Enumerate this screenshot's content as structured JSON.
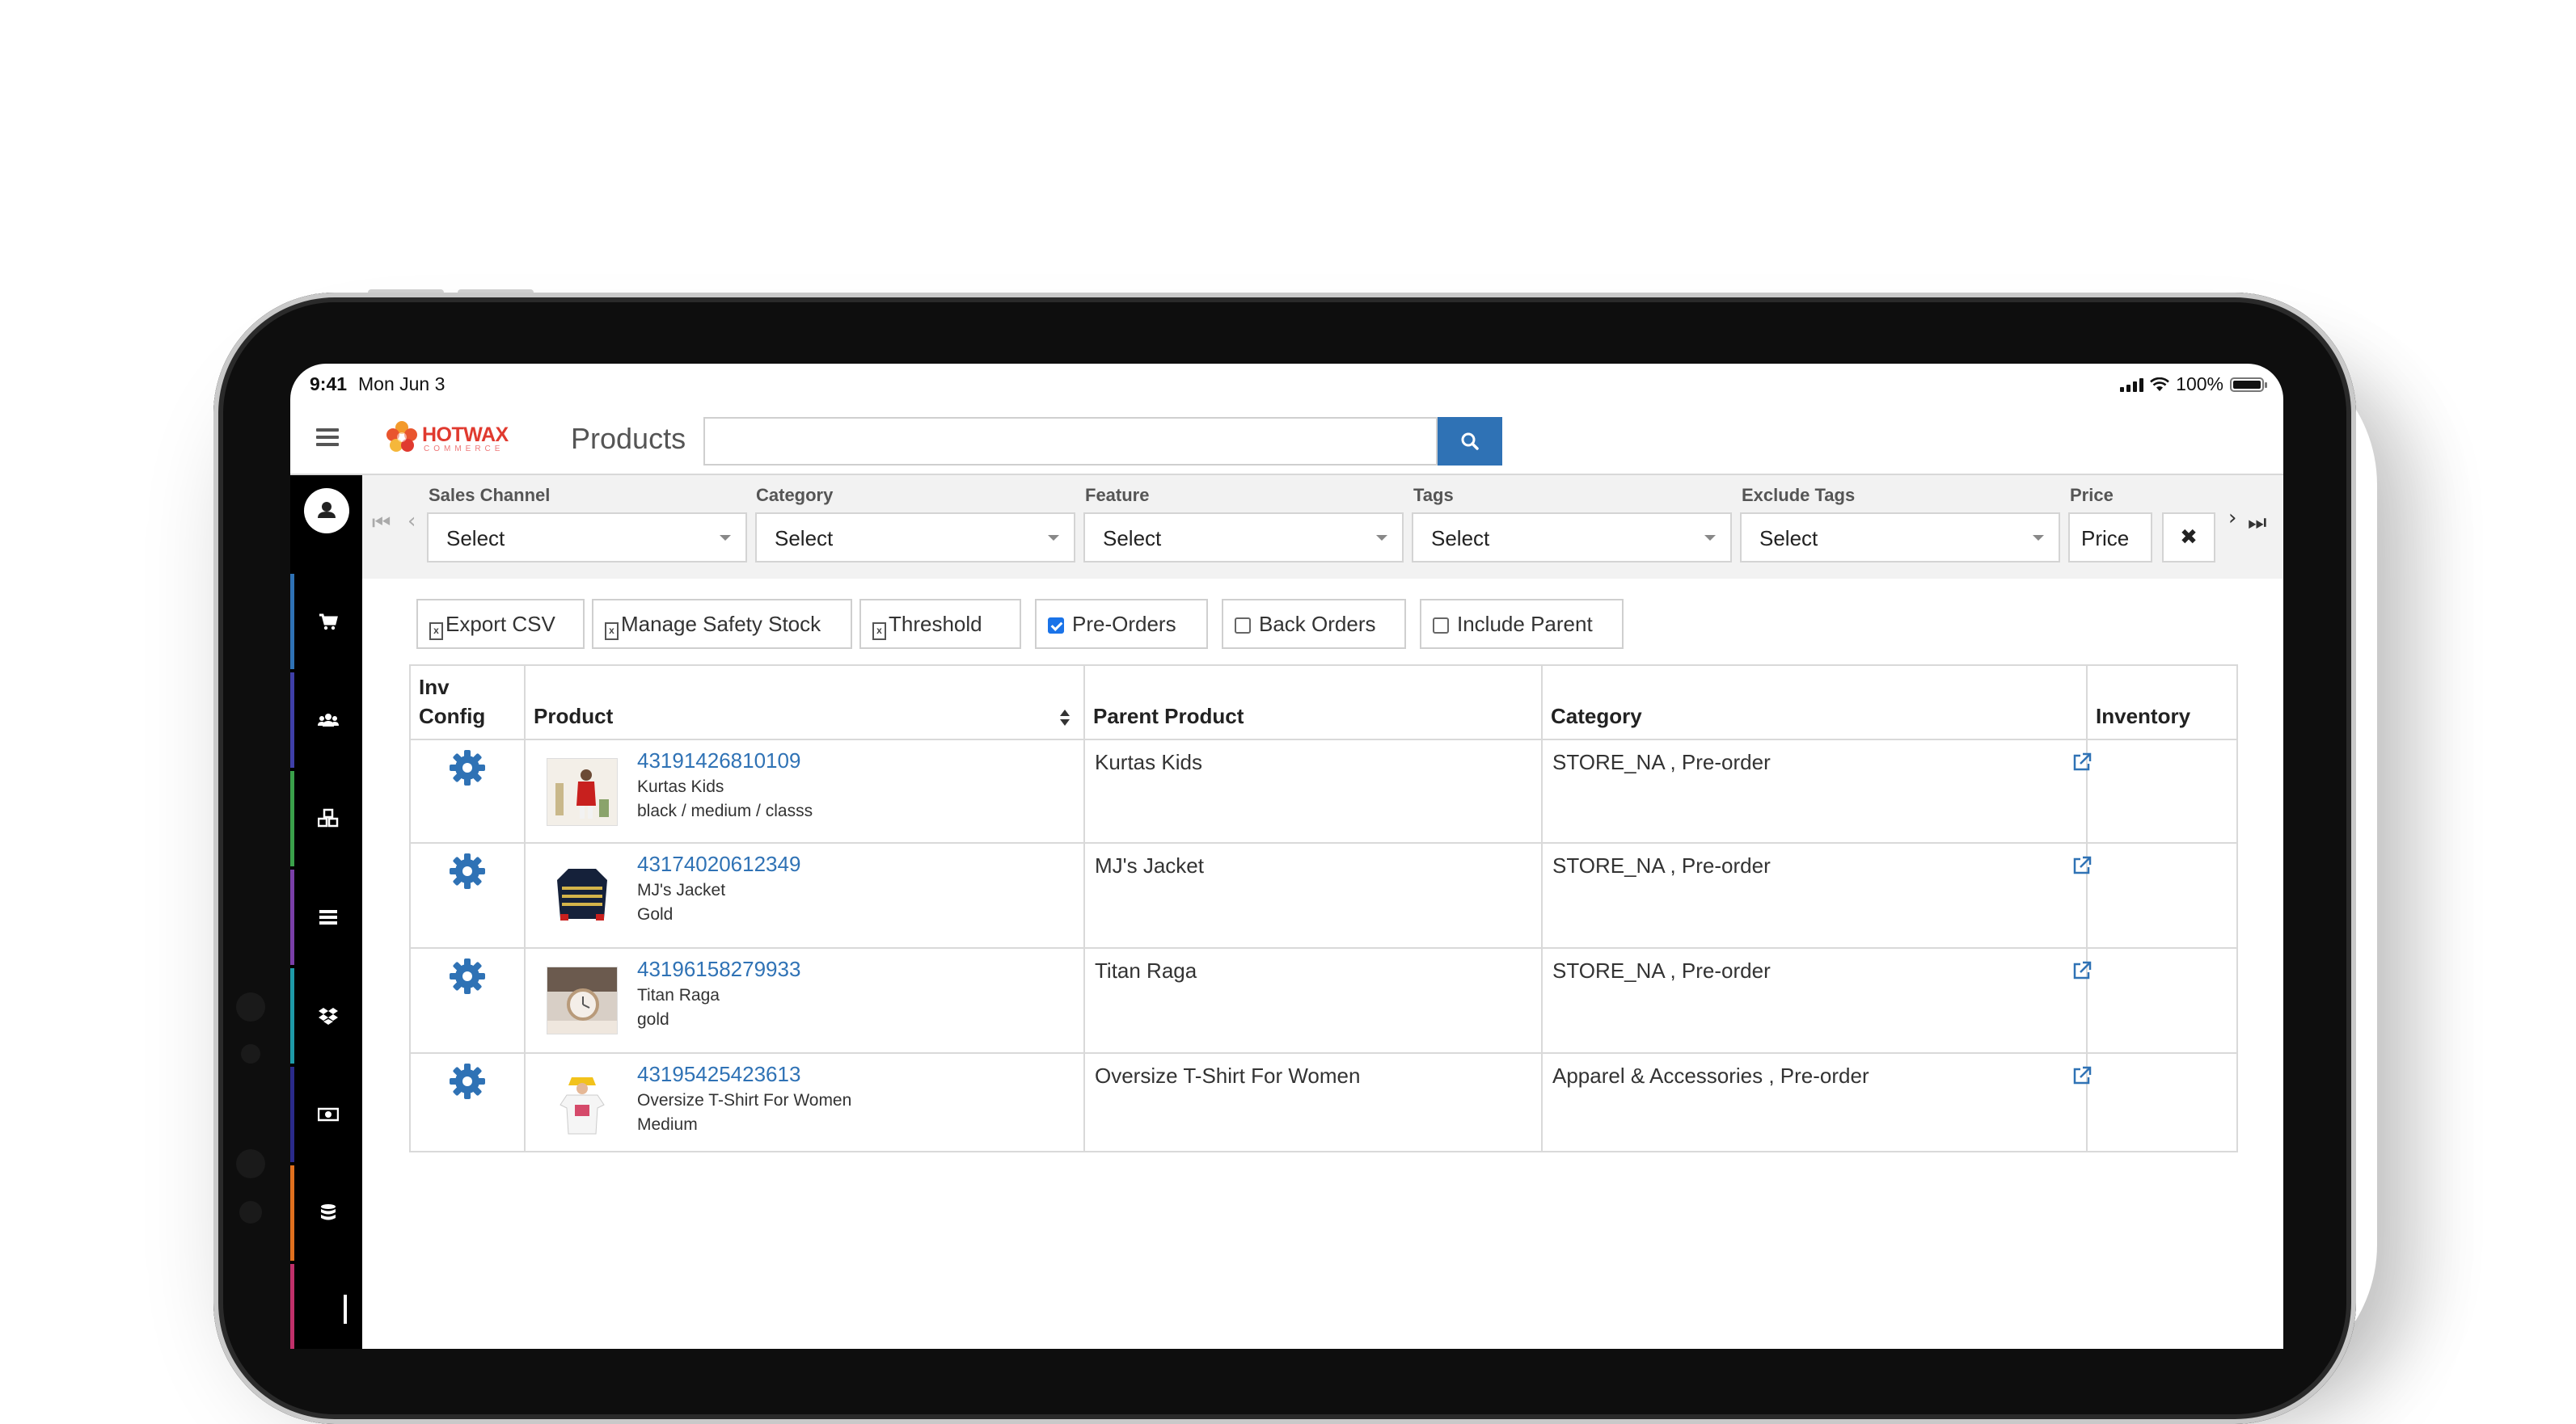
{
  "status_bar": {
    "time": "9:41",
    "date": "Mon Jun 3",
    "battery": "100%"
  },
  "header": {
    "logo_text": "HOTWAX",
    "logo_sub": "COMMERCE",
    "title": "Products",
    "search_placeholder": "",
    "search_icon": "search-icon"
  },
  "sidebar": {
    "items": [
      {
        "name": "orders",
        "icon": "cart-icon",
        "color": "#2f72b5"
      },
      {
        "name": "customers",
        "icon": "users-icon",
        "color": "#3f3fa8"
      },
      {
        "name": "products",
        "icon": "cubes-icon",
        "color": "#3aa04a"
      },
      {
        "name": "catalog",
        "icon": "list-icon",
        "color": "#7a3fa8"
      },
      {
        "name": "inventory",
        "icon": "dropbox-icon",
        "color": "#1e9aa8"
      },
      {
        "name": "finance",
        "icon": "money-icon",
        "color": "#2a2a8a"
      },
      {
        "name": "data",
        "icon": "database-icon",
        "color": "#e0701e"
      },
      {
        "name": "more",
        "icon": "more-icon",
        "color": "#c0306a"
      }
    ]
  },
  "filters": {
    "sales_channel": {
      "label": "Sales Channel",
      "value": "Select"
    },
    "category": {
      "label": "Category",
      "value": "Select"
    },
    "feature": {
      "label": "Feature",
      "value": "Select"
    },
    "tags": {
      "label": "Tags",
      "value": "Select"
    },
    "exclude_tags": {
      "label": "Exclude Tags",
      "value": "Select"
    },
    "price": {
      "label": "Price",
      "value": "Price"
    },
    "clear_label": "✖"
  },
  "actions": {
    "export_csv": "Export CSV",
    "manage_safety_stock": "Manage Safety Stock",
    "threshold": "Threshold",
    "pre_orders": {
      "label": "Pre-Orders",
      "checked": true
    },
    "back_orders": {
      "label": "Back Orders",
      "checked": false
    },
    "include_parent": {
      "label": "Include Parent",
      "checked": false
    }
  },
  "table": {
    "headers": {
      "inv_config": "Inv Config",
      "product": "Product",
      "parent_product": "Parent Product",
      "category": "Category",
      "inventory": "Inventory"
    },
    "rows": [
      {
        "id": "43191426810109",
        "name": "Kurtas Kids",
        "variant": "black / medium / classs",
        "parent": "Kurtas Kids",
        "category": "STORE_NA , Pre-order",
        "thumb": "kids-kurta"
      },
      {
        "id": "43174020612349",
        "name": "MJ's Jacket",
        "variant": "Gold",
        "parent": "MJ's Jacket",
        "category": "STORE_NA , Pre-order",
        "thumb": "jacket"
      },
      {
        "id": "43196158279933",
        "name": "Titan Raga",
        "variant": "gold",
        "parent": "Titan Raga",
        "category": "STORE_NA , Pre-order",
        "thumb": "watch"
      },
      {
        "id": "43195425423613",
        "name": "Oversize T-Shirt For Women",
        "variant": "Medium",
        "parent": "Oversize T-Shirt For Women",
        "category": "Apparel & Accessories , Pre-order",
        "thumb": "tshirt"
      }
    ]
  }
}
